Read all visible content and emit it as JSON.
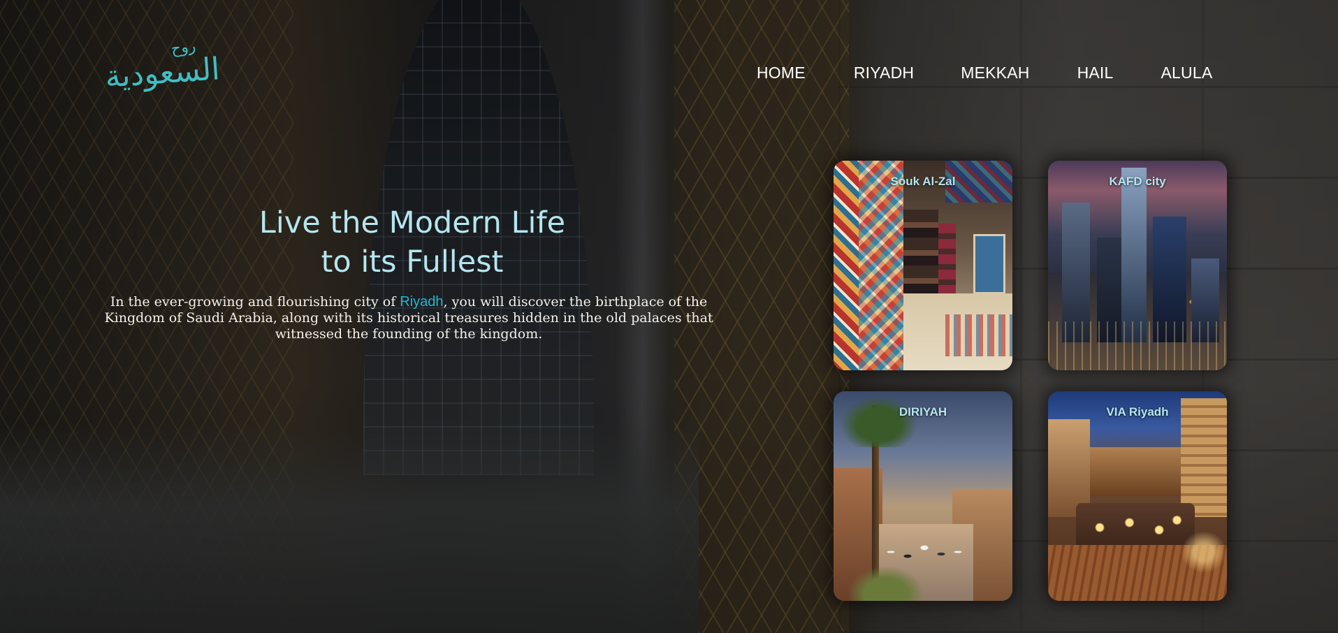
{
  "logo": {
    "small_text": "روح",
    "main_text": "السعودية"
  },
  "nav": {
    "items": [
      {
        "label": "HOME"
      },
      {
        "label": "RIYADH"
      },
      {
        "label": "MEKKAH"
      },
      {
        "label": "HAIL"
      },
      {
        "label": "ALULA"
      }
    ]
  },
  "hero": {
    "title_line1": "Live the Modern Life",
    "title_line2": "to its Fullest",
    "text_before": "In the ever-growing and flourishing city of ",
    "link_text": "Riyadh",
    "text_after": ", you will discover the birthplace of the Kingdom of Saudi Arabia, along with its historical treasures hidden in the old palaces that witnessed the founding of the kingdom."
  },
  "cards": [
    {
      "label": "Souk Al-Zal"
    },
    {
      "label": "KAFD city"
    },
    {
      "label": "DIRIYAH"
    },
    {
      "label": "VIA Riyadh"
    }
  ],
  "colors": {
    "accent_cyan": "#b5e6ee",
    "link_blue": "#22b6d8",
    "logo_teal": "#3fbfc4"
  }
}
